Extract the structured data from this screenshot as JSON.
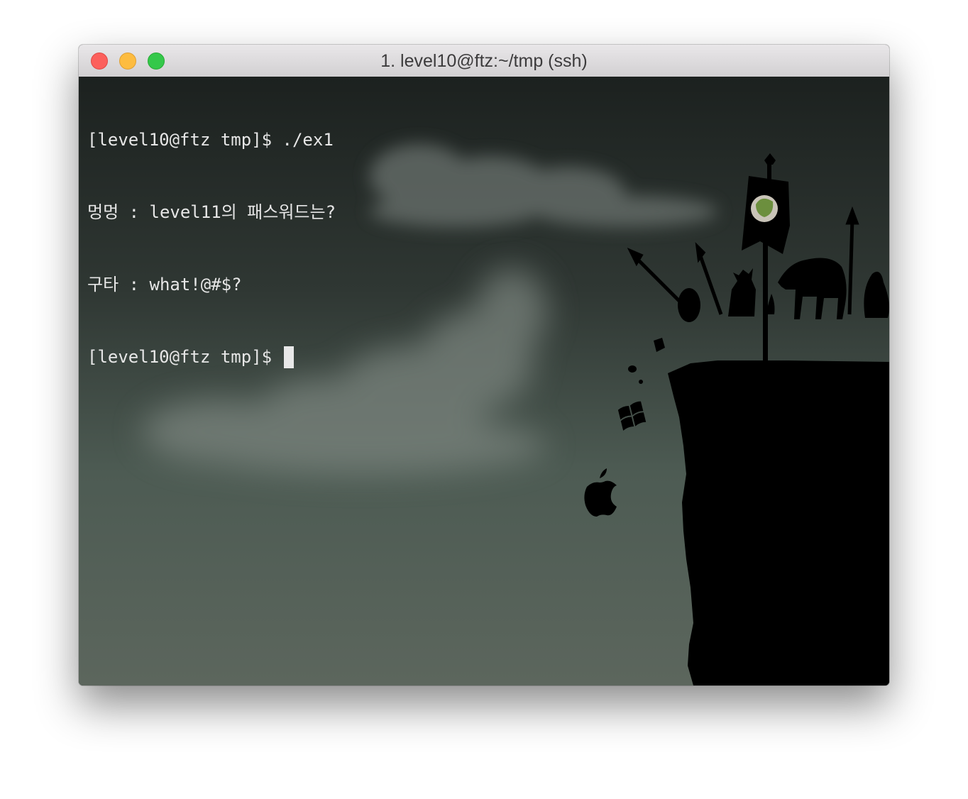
{
  "window": {
    "title": "1. level10@ftz:~/tmp (ssh)",
    "buttons": [
      "close-button",
      "minimize-button",
      "zoom-button"
    ]
  },
  "terminal": {
    "lines": [
      "[level10@ftz tmp]$ ./ex1",
      "멍멍 : level11의 패스워드는?",
      "구타 : what!@#$?"
    ],
    "prompt": "[level10@ftz tmp]$ "
  },
  "colors": {
    "close": "#fc605c",
    "minimize": "#fdbc40",
    "zoom": "#34c84a",
    "terminal_text": "#e6e6e6"
  },
  "icons": [
    "apple-logo-icon",
    "windows-logo-icon",
    "leaf-icon"
  ]
}
